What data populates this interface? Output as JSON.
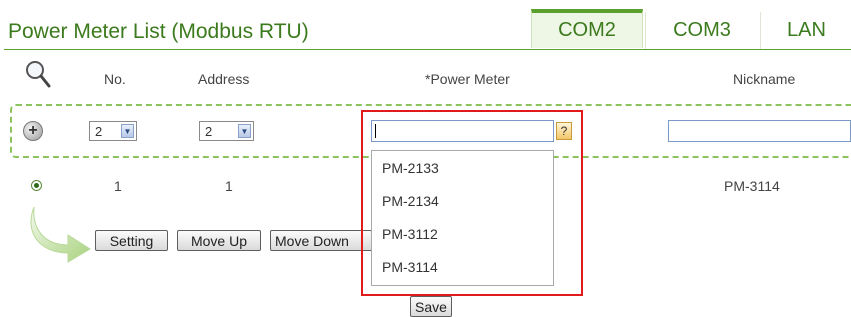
{
  "page": {
    "title": "Power Meter List (Modbus RTU)"
  },
  "tabs": [
    {
      "label": "COM2",
      "active": true
    },
    {
      "label": "COM3",
      "active": false
    },
    {
      "label": "LAN",
      "active": false
    }
  ],
  "table": {
    "headers": {
      "no": "No.",
      "address": "Address",
      "power_meter": "*Power Meter",
      "nickname": "Nickname"
    },
    "add_row": {
      "no_value": "2",
      "address_value": "2",
      "power_meter_value": "",
      "nickname_value": "",
      "help_label": "?"
    },
    "rows": [
      {
        "no": "1",
        "address": "1",
        "power_meter": "",
        "nickname": "PM-3114"
      }
    ]
  },
  "dropdown": {
    "options": [
      "PM-2133",
      "PM-2134",
      "PM-3112",
      "PM-3114"
    ]
  },
  "actions": {
    "setting": "Setting",
    "move_up": "Move Up",
    "move_down": "Move Down",
    "save": "Save"
  },
  "colors": {
    "accent": "#5aa02c",
    "title": "#3c7a1e",
    "highlight": "#e11b1b"
  }
}
